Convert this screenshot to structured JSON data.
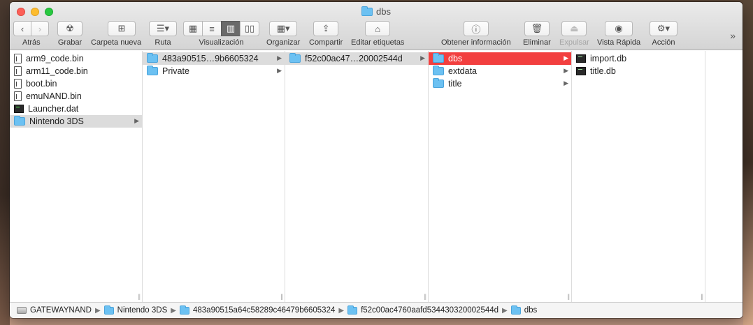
{
  "window": {
    "title": "dbs"
  },
  "toolbar": {
    "back": "Atrás",
    "burn": "Grabar",
    "new_folder": "Carpeta nueva",
    "path": "Ruta",
    "view": "Visualización",
    "arrange": "Organizar",
    "share": "Compartir",
    "tags": "Editar etiquetas",
    "get_info": "Obtener información",
    "delete": "Eliminar",
    "eject": "Expulsar",
    "quick_look": "Vista Rápida",
    "action": "Acción",
    "overflow": "»"
  },
  "columns": {
    "col1": [
      {
        "name": "arm9_code.bin",
        "kind": "file"
      },
      {
        "name": "arm11_code.bin",
        "kind": "file"
      },
      {
        "name": "boot.bin",
        "kind": "file"
      },
      {
        "name": "emuNAND.bin",
        "kind": "file"
      },
      {
        "name": "Launcher.dat",
        "kind": "exec"
      },
      {
        "name": "Nintendo 3DS",
        "kind": "folder",
        "selected": "gray"
      }
    ],
    "col2": [
      {
        "name": "483a90515…9b6605324",
        "kind": "folder",
        "selected": "gray"
      },
      {
        "name": "Private",
        "kind": "folder"
      }
    ],
    "col3": [
      {
        "name": "f52c00ac47…20002544d",
        "kind": "folder",
        "selected": "gray"
      }
    ],
    "col4": [
      {
        "name": "dbs",
        "kind": "folder",
        "selected": "red"
      },
      {
        "name": "extdata",
        "kind": "folder"
      },
      {
        "name": "title",
        "kind": "folder"
      }
    ],
    "col5": [
      {
        "name": "import.db",
        "kind": "db"
      },
      {
        "name": "title.db",
        "kind": "db"
      }
    ]
  },
  "pathbar": {
    "drive": "GATEWAYNAND",
    "p1": "Nintendo 3DS",
    "p2": "483a90515a64c58289c46479b6605324",
    "p3": "f52c00ac4760aafd534430320002544d",
    "p4": "dbs"
  },
  "colors": {
    "selection_red": "#f23f3f",
    "folder_blue": "#6cc1f2"
  }
}
